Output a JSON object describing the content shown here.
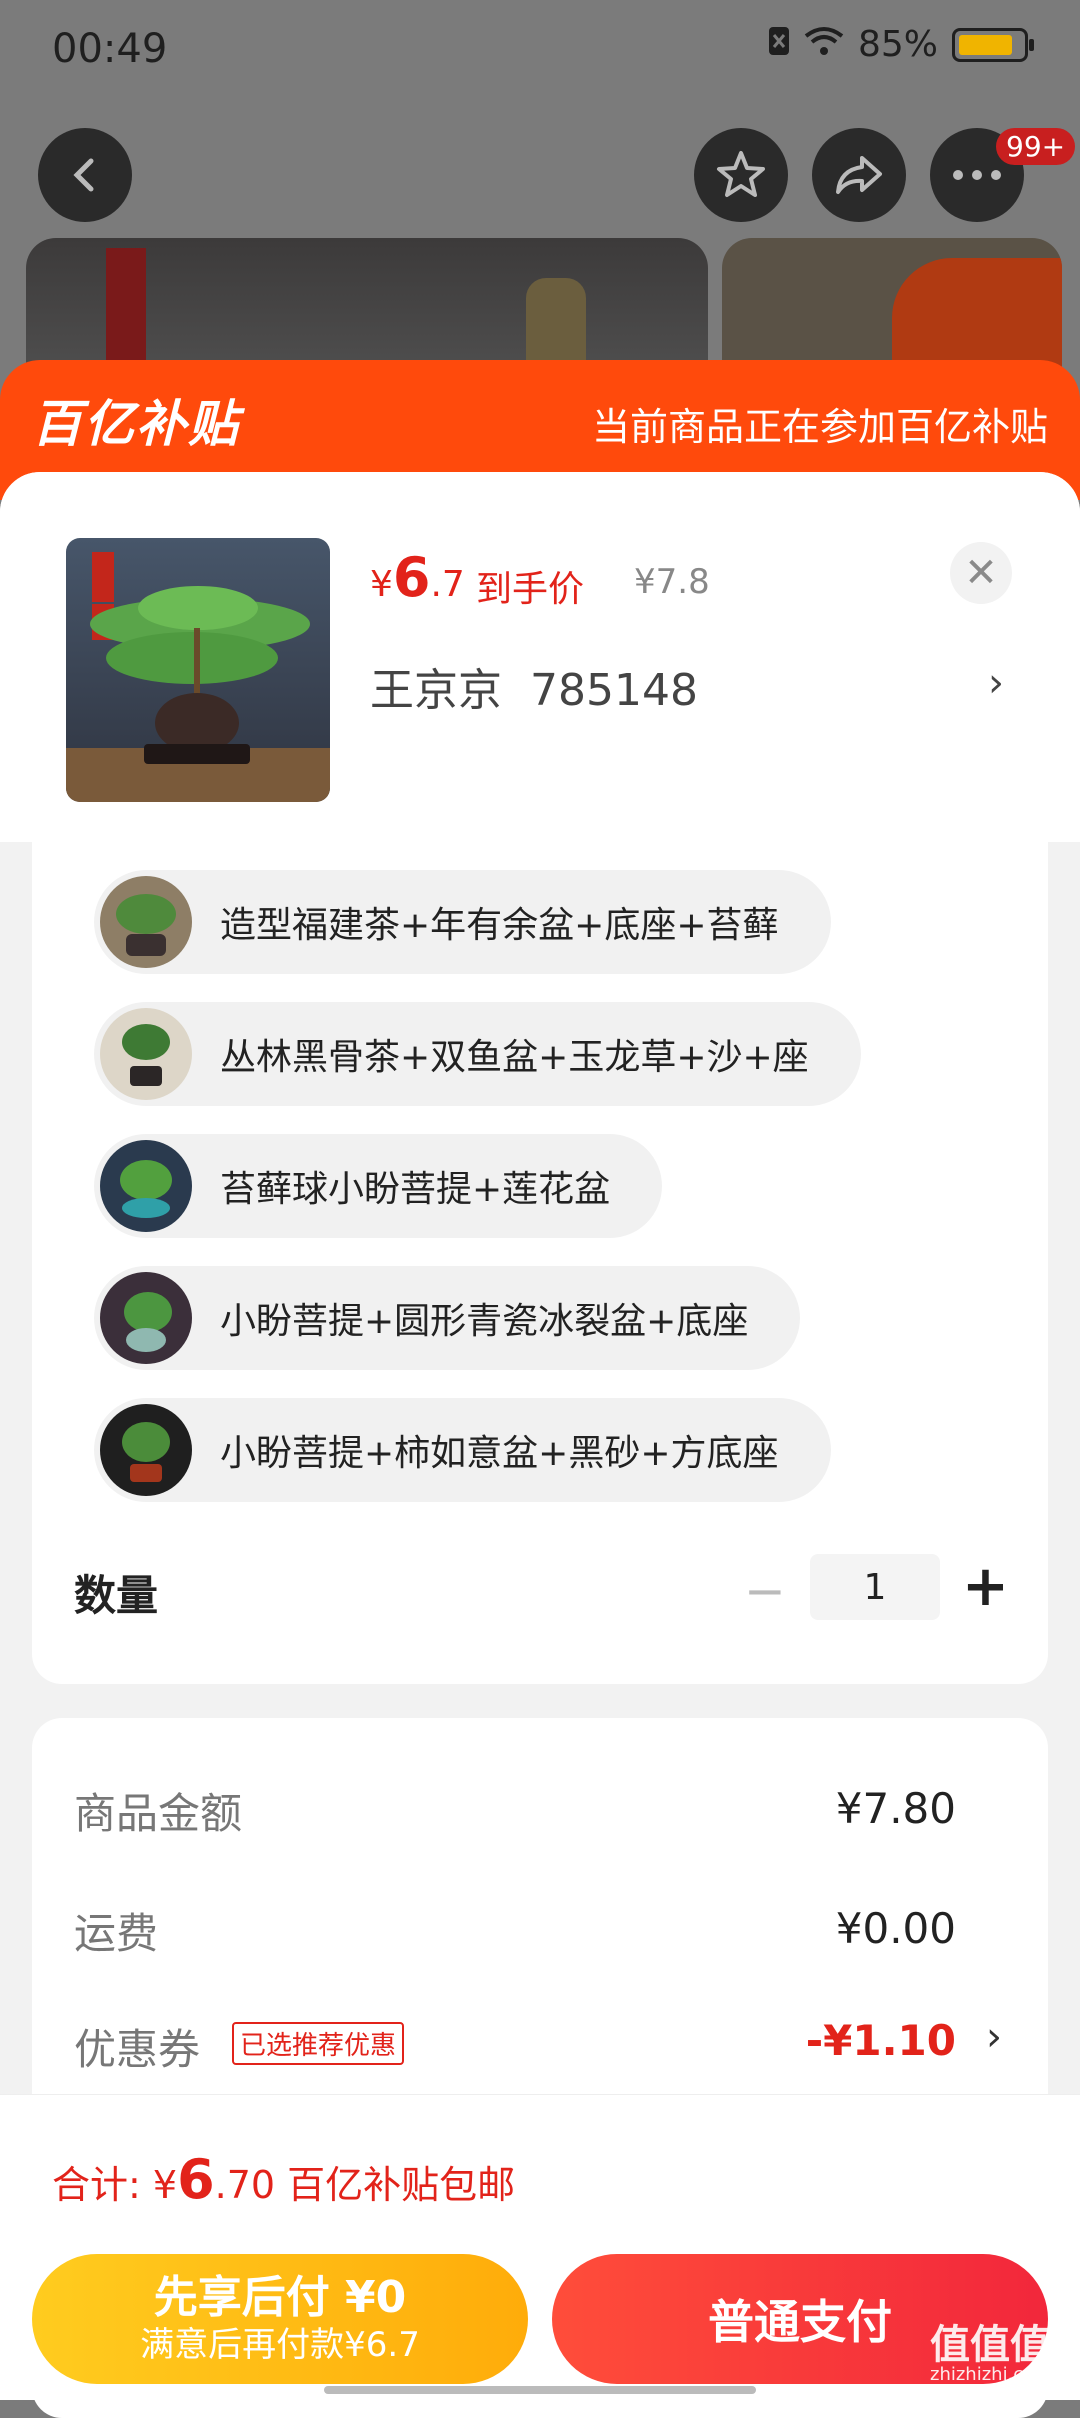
{
  "status_bar": {
    "time": "00:49",
    "battery": "85%",
    "battery_level": 0.85
  },
  "header_badge": "99+",
  "banner": {
    "brand": "百亿补贴",
    "note": "当前商品正在参加百亿补贴"
  },
  "product": {
    "price_symbol": "¥",
    "price_int": "6",
    "price_dec": ".7",
    "price_label": "到手价",
    "original_price": "¥7.8",
    "sku_name": "王京京  785148"
  },
  "options": [
    {
      "label": "造型福建茶+年有余盆+底座+苔藓"
    },
    {
      "label": "丛林黑骨茶+双鱼盆+玉龙草+沙+座"
    },
    {
      "label": "苔藓球小盼菩提+莲花盆"
    },
    {
      "label": "小盼菩提+圆形青瓷冰裂盆+底座"
    },
    {
      "label": "小盼菩提+柿如意盆+黑砂+方底座"
    }
  ],
  "quantity": {
    "label": "数量",
    "value": "1",
    "minus": "−",
    "plus": "+"
  },
  "fees": {
    "goods_label": "商品金额",
    "goods_value": "¥7.80",
    "shipping_label": "运费",
    "shipping_value": "¥0.00",
    "coupon_label": "优惠券",
    "coupon_tag": "已选推荐优惠",
    "coupon_value": "-¥1.10"
  },
  "total": {
    "prefix": "合计: ¥",
    "int": "6",
    "dec": ".70",
    "suffix": " 百亿补贴包邮"
  },
  "buttons": {
    "pay_later_line1": "先享后付 ¥0",
    "pay_later_line2": "满意后再付款¥6.7",
    "pay_normal": "普通支付"
  },
  "watermark": {
    "main": "值值值",
    "sub": "zhizhizhi.com"
  },
  "colors": {
    "brand_orange": "#ff4a0c",
    "price_red": "#e2231a",
    "pay_red": "#f2273b",
    "pay_later_yellow": "#ffb80f"
  }
}
